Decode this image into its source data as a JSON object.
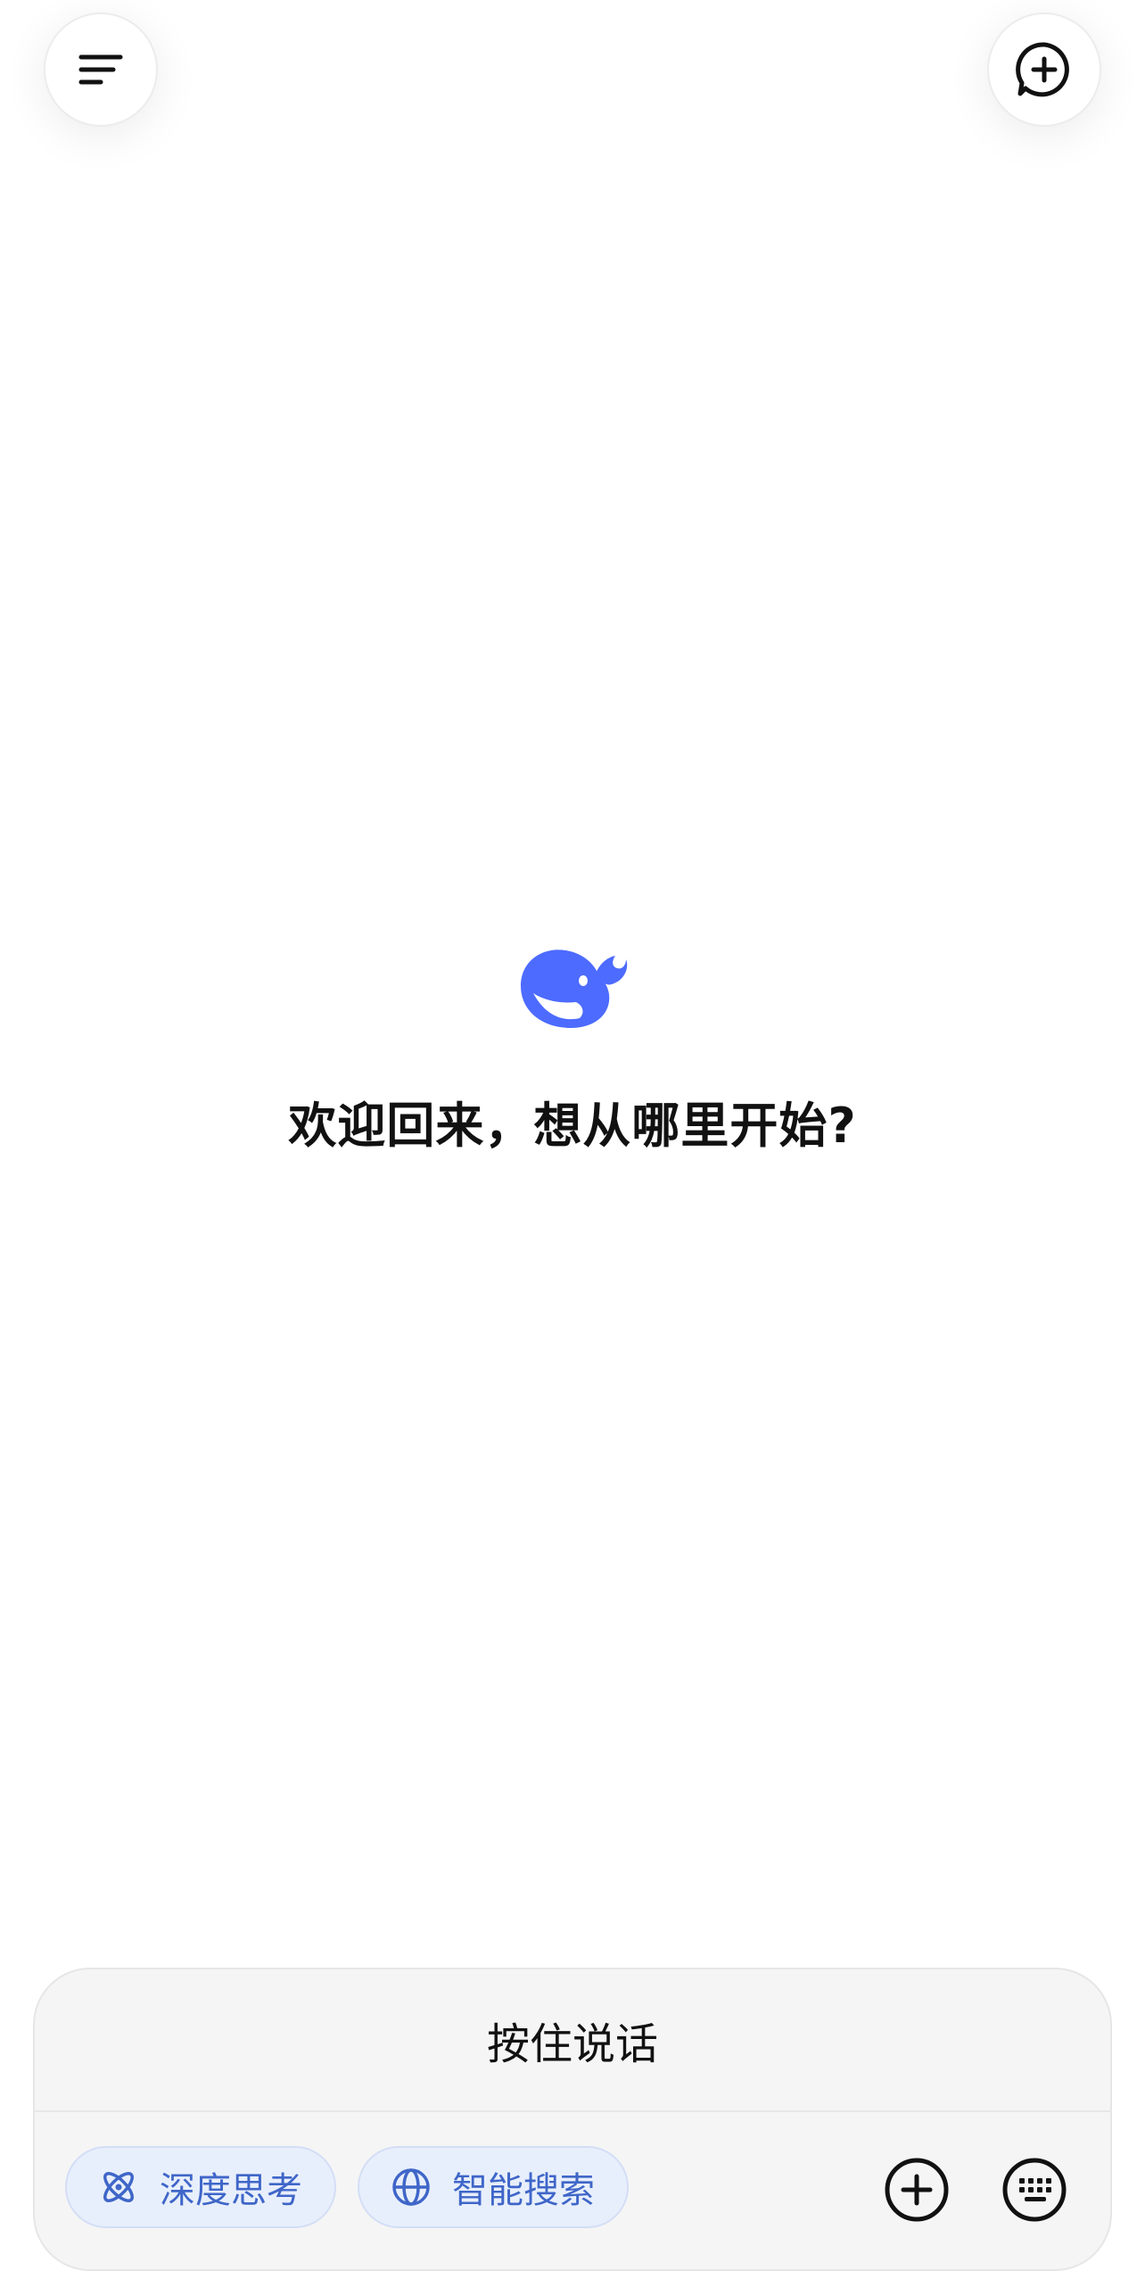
{
  "header": {
    "menu_icon": "menu-icon",
    "new_chat_icon": "new-chat-icon"
  },
  "center": {
    "logo_icon": "whale-logo-icon",
    "title": "欢迎回来，想从哪里开始?"
  },
  "composer": {
    "hold_to_talk_label": "按住说话",
    "chips": [
      {
        "label": "深度思考",
        "icon": "atom-icon"
      },
      {
        "label": "智能搜索",
        "icon": "globe-icon"
      }
    ],
    "add_icon": "plus-circle-icon",
    "keyboard_icon": "keyboard-icon"
  },
  "colors": {
    "accent": "#4D6BFE",
    "chip_text": "#3F66C8",
    "chip_bg": "#E8EFFC",
    "composer_bg": "#F5F5F5"
  }
}
